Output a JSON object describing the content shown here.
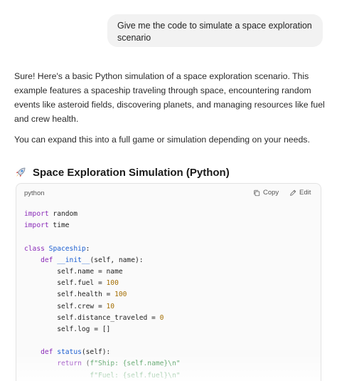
{
  "user_message": {
    "line1": "Give me the code to simulate a space exploration",
    "line2": "scenario"
  },
  "answer": {
    "paragraph1": "Sure! Here's a basic Python simulation of a space exploration scenario. This example features a spaceship traveling through space, encountering random events like asteroid fields, discovering planets, and managing resources like fuel and crew health.",
    "paragraph2": "You can expand this into a full game or simulation depending on your needs."
  },
  "section": {
    "icon": "rocket-icon",
    "title": "Space Exploration Simulation (Python)"
  },
  "code_block": {
    "language": "python",
    "copy_label": "Copy",
    "edit_label": "Edit",
    "lines": [
      [
        {
          "t": "import",
          "c": "kw"
        },
        {
          "t": " random",
          "c": ""
        }
      ],
      [
        {
          "t": "import",
          "c": "kw"
        },
        {
          "t": " time",
          "c": ""
        }
      ],
      [],
      [
        {
          "t": "class",
          "c": "kw"
        },
        {
          "t": " ",
          "c": ""
        },
        {
          "t": "Spaceship",
          "c": "cls"
        },
        {
          "t": ":",
          "c": ""
        }
      ],
      [
        {
          "t": "    ",
          "c": ""
        },
        {
          "t": "def",
          "c": "kw"
        },
        {
          "t": " ",
          "c": ""
        },
        {
          "t": "__init__",
          "c": "fn"
        },
        {
          "t": "(self, name):",
          "c": ""
        }
      ],
      [
        {
          "t": "        self.name = name",
          "c": ""
        }
      ],
      [
        {
          "t": "        self.fuel = ",
          "c": ""
        },
        {
          "t": "100",
          "c": "num"
        }
      ],
      [
        {
          "t": "        self.health = ",
          "c": ""
        },
        {
          "t": "100",
          "c": "num"
        }
      ],
      [
        {
          "t": "        self.crew = ",
          "c": ""
        },
        {
          "t": "10",
          "c": "num"
        }
      ],
      [
        {
          "t": "        self.distance_traveled = ",
          "c": ""
        },
        {
          "t": "0",
          "c": "num"
        }
      ],
      [
        {
          "t": "        self.log = []",
          "c": ""
        }
      ],
      [],
      [
        {
          "t": "    ",
          "c": ""
        },
        {
          "t": "def",
          "c": "kw"
        },
        {
          "t": " ",
          "c": ""
        },
        {
          "t": "status",
          "c": "fn"
        },
        {
          "t": "(self):",
          "c": ""
        }
      ],
      [
        {
          "t": "        ",
          "c": ""
        },
        {
          "t": "return",
          "c": "kw"
        },
        {
          "t": " (",
          "c": ""
        },
        {
          "t": "f\"Ship: {self.name}\\n\"",
          "c": "str"
        }
      ],
      [
        {
          "t": "                ",
          "c": ""
        },
        {
          "t": "f\"Fuel: {self.fuel}\\n\"",
          "c": "str"
        }
      ]
    ]
  },
  "colors": {
    "bubble_bg": "#f2f2f2",
    "keyword": "#8a2bb8",
    "function": "#1c5fd1",
    "number": "#a36d00",
    "string": "#2c8a3d"
  }
}
